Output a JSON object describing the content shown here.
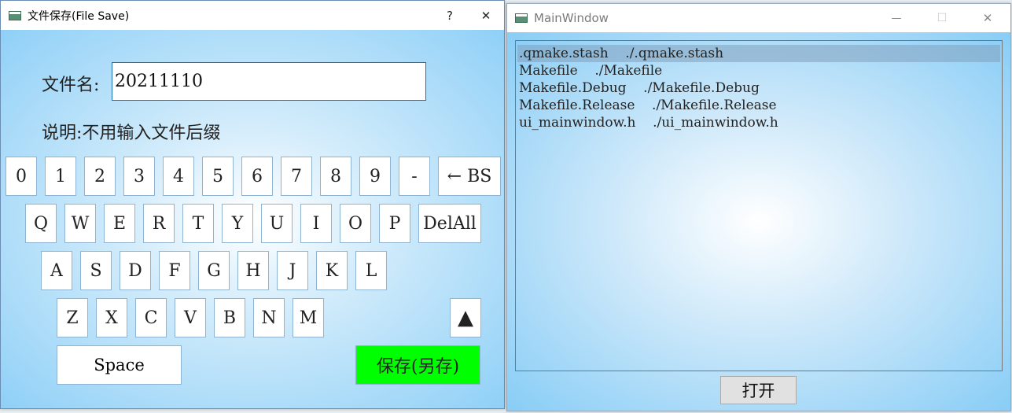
{
  "dialog": {
    "title": "文件保存(File Save)",
    "help_label": "?",
    "close_label": "✕",
    "filename_label": "文件名:",
    "filename_value": "20211110",
    "note_label": "说明:不用输入文件后缀",
    "keys_row1": [
      "0",
      "1",
      "2",
      "3",
      "4",
      "5",
      "6",
      "7",
      "8",
      "9",
      "-"
    ],
    "backspace_label": "← BS",
    "keys_row2": [
      "Q",
      "W",
      "E",
      "R",
      "T",
      "Y",
      "U",
      "I",
      "O",
      "P"
    ],
    "delall_label": "DelAll",
    "keys_row3": [
      "A",
      "S",
      "D",
      "F",
      "G",
      "H",
      "J",
      "K",
      "L"
    ],
    "keys_row4": [
      "Z",
      "X",
      "C",
      "V",
      "B",
      "N",
      "M"
    ],
    "shift_label": "▲",
    "space_label": "Space",
    "save_label": "保存(另存)"
  },
  "main_window": {
    "title": "MainWindow",
    "minimize_label": "—",
    "maximize_label": "☐",
    "close_label": "✕",
    "files": [
      ".qmake.stash    ./.qmake.stash",
      "Makefile    ./Makefile",
      "Makefile.Debug    ./Makefile.Debug",
      "Makefile.Release    ./Makefile.Release",
      "ui_mainwindow.h    ./ui_mainwindow.h"
    ],
    "selected_index": 0,
    "open_label": "打开"
  },
  "colors": {
    "save_button": "#00ff00",
    "background_edge": "#8fd0f7",
    "selection": "#8aa6c2"
  }
}
